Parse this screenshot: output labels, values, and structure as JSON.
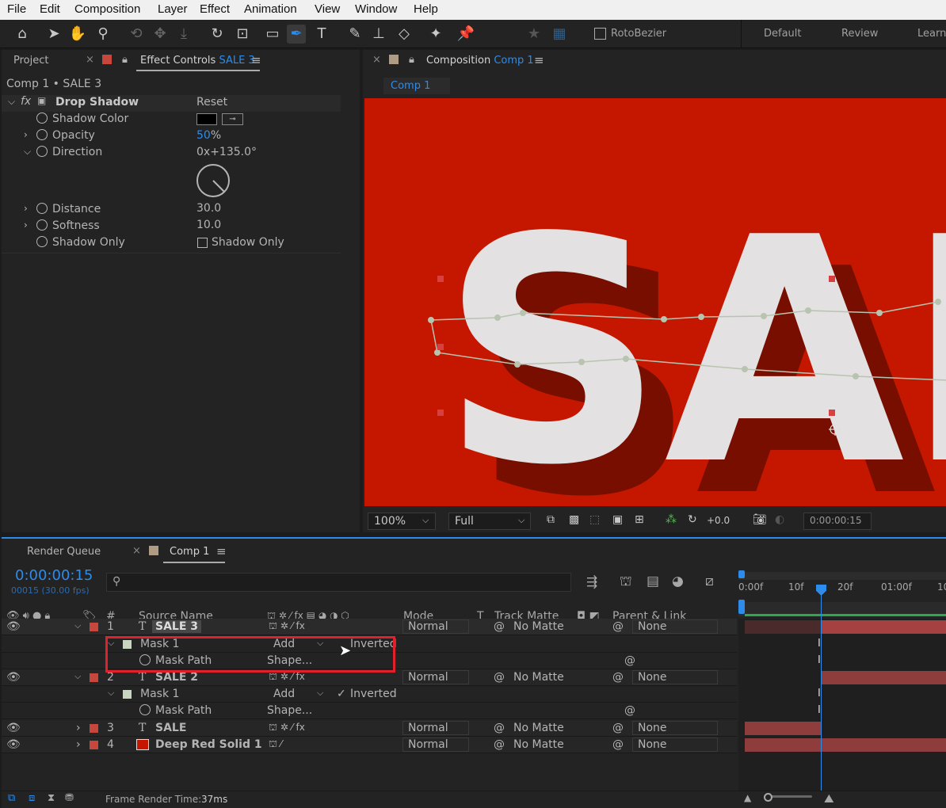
{
  "menu": [
    "File",
    "Edit",
    "Composition",
    "Layer",
    "Effect",
    "Animation",
    "View",
    "Window",
    "Help"
  ],
  "toolbar": {
    "rotobezier_label": "RotoBezier",
    "workspaces": [
      "Default",
      "Review",
      "Learn"
    ]
  },
  "left_panel": {
    "tab_project": "Project",
    "tab_effect_controls": "Effect Controls",
    "tab_effect_controls_target": "SALE 3",
    "breadcrumb": "Comp 1 • SALE 3",
    "effect_name": "Drop Shadow",
    "reset": "Reset",
    "props": {
      "shadow_color": "Shadow Color",
      "opacity": "Opacity",
      "opacity_value": "50",
      "opacity_unit": "%",
      "direction": "Direction",
      "direction_value": "0x+135.0°",
      "distance": "Distance",
      "distance_value": "30.0",
      "softness": "Softness",
      "softness_value": "10.0",
      "shadow_only": "Shadow Only",
      "shadow_only_checkbox": "Shadow Only"
    }
  },
  "comp_panel": {
    "tab_label": "Composition",
    "tab_target": "Comp 1",
    "flow_tab": "Comp 1",
    "canvas_text": "SAL",
    "zoom": "100%",
    "resolution": "Full",
    "exposure": "+0.0",
    "timecode": "0:00:00:15"
  },
  "timeline": {
    "tab_render_queue": "Render Queue",
    "tab_comp": "Comp 1",
    "current_time": "0:00:00:15",
    "frame_info": "00015 (30.00 fps)",
    "ruler": [
      "0:00f",
      "10f",
      "20f",
      "01:00f",
      "10"
    ],
    "headers": {
      "num": "#",
      "source": "Source Name",
      "mode": "Mode",
      "t": "T",
      "track_matte": "Track Matte",
      "parent": "Parent & Link"
    },
    "layers": [
      {
        "num": "1",
        "name": "SALE 3",
        "mode": "Normal",
        "matte": "No Matte",
        "parent": "None"
      },
      {
        "num": "2",
        "name": "SALE 2",
        "mode": "Normal",
        "matte": "No Matte",
        "parent": "None"
      },
      {
        "num": "3",
        "name": "SALE",
        "mode": "Normal",
        "matte": "No Matte",
        "parent": "None"
      },
      {
        "num": "4",
        "name": "Deep Red Solid 1",
        "mode": "Normal",
        "matte": "No Matte",
        "parent": "None"
      }
    ],
    "mask": {
      "name": "Mask 1",
      "mode": "Add",
      "inverted": "Inverted",
      "path": "Mask Path",
      "path_value": "Shape..."
    },
    "footer_label": "Frame Render Time:",
    "footer_value": "37ms"
  },
  "colors": {
    "accent": "#2d8ceb",
    "canvas_red": "#c51700",
    "highlight_red": "#e0202a",
    "layer_label_red": "#c8473d",
    "timeline_bar": "#8f3c3c"
  }
}
